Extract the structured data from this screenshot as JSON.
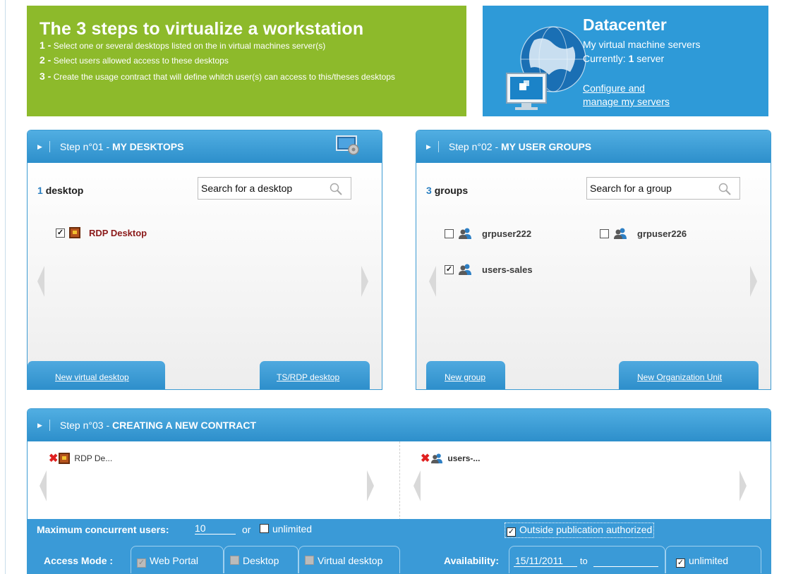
{
  "intro": {
    "title": "The 3 steps to virtualize a workstation",
    "steps": [
      {
        "num": "1 -",
        "text": "Select one or several desktops listed on the in virtual machines server(s)"
      },
      {
        "num": "2 -",
        "text": "Select users allowed access to these desktops"
      },
      {
        "num": "3 -",
        "text": "Create the usage contract that will define whitch user(s) can access to this/theses desktops"
      }
    ]
  },
  "datacenter": {
    "title": "Datacenter",
    "subtitle": "My virtual machine servers",
    "current_prefix": "Currently:",
    "current_count": "1",
    "current_suffix": "server",
    "link_line1": "Configure and",
    "link_line2": "manage my servers"
  },
  "step1": {
    "prefix": "Step n°01 - ",
    "title": "MY DESKTOPS",
    "count": "1",
    "count_label": "desktop",
    "search_placeholder": "Search for a desktop",
    "items": [
      {
        "label": "RDP Desktop",
        "checked": true,
        "mark": "✓"
      }
    ],
    "buttons": {
      "left": "New virtual desktop",
      "right": "TS/RDP desktop"
    }
  },
  "step2": {
    "prefix": "Step n°02 - ",
    "title": "MY USER GROUPS",
    "count": "3",
    "count_label": "groups",
    "search_placeholder": "Search for a group",
    "items": [
      {
        "label": "grpuser222",
        "checked": false,
        "mark": ""
      },
      {
        "label": "grpuser226",
        "checked": false,
        "mark": ""
      },
      {
        "label": "users-sales",
        "checked": true,
        "mark": "✓"
      }
    ],
    "buttons": {
      "left": "New group",
      "right": "New Organization Unit"
    }
  },
  "step3": {
    "prefix": "Step n°03 - ",
    "title": "CREATING A NEW CONTRACT",
    "selected_desktop": "RDP De...",
    "selected_group": "users-...",
    "max_users_label": "Maximum concurrent users:",
    "max_users_value": "10",
    "or_label": "or",
    "unlimited_label": "unlimited",
    "outside_pub_label": "Outside publication authorized",
    "outside_pub_mark": "✓",
    "access_mode_label": "Access Mode :",
    "modes": [
      {
        "label": "Web Portal",
        "checked": true,
        "mark": "✓"
      },
      {
        "label": "Desktop",
        "checked": false,
        "mark": ""
      },
      {
        "label": "Virtual desktop",
        "checked": false,
        "mark": ""
      }
    ],
    "availability_label": "Availability:",
    "availability_from": "15/11/2011",
    "availability_to_label": "to",
    "availability_unlimited": "unlimited",
    "availability_unlimited_mark": "✓"
  },
  "colors": {
    "green_banner": "#8dba2b",
    "blue_banner": "#2e9ad8",
    "panel_blue": "#3a9ad7",
    "remove_red": "#e02020"
  }
}
